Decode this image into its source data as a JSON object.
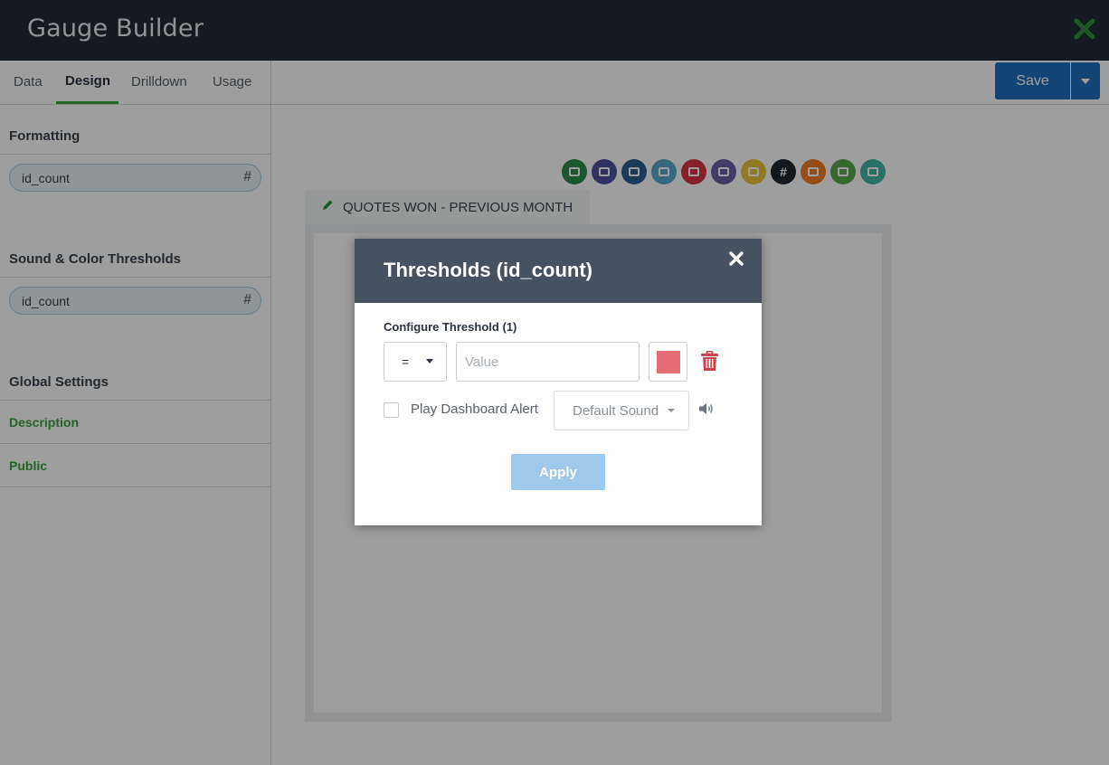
{
  "app": {
    "title": "Gauge Builder"
  },
  "sidebar": {
    "tabs": [
      {
        "label": "Data"
      },
      {
        "label": "Design"
      },
      {
        "label": "Drilldown"
      },
      {
        "label": "Usage"
      }
    ],
    "active_tab": "Design",
    "formatting": {
      "title": "Formatting",
      "field": "id_count",
      "field_type_symbol": "#"
    },
    "thresholds": {
      "title": "Sound & Color Thresholds",
      "field": "id_count",
      "field_type_symbol": "#"
    },
    "global": {
      "title": "Global Settings",
      "links": [
        "Description",
        "Public"
      ]
    }
  },
  "toolbar": {
    "save_label": "Save"
  },
  "chart_types": [
    {
      "icon": "funnel-icon",
      "color": "#2e8b4f"
    },
    {
      "icon": "camera-icon",
      "color": "#4c4f9e"
    },
    {
      "icon": "table-icon",
      "color": "#2c5d8f"
    },
    {
      "icon": "bar-chart-icon",
      "color": "#5aa7c9"
    },
    {
      "icon": "line-chart-icon",
      "color": "#d6364a"
    },
    {
      "icon": "list-icon",
      "color": "#6b5fa5"
    },
    {
      "icon": "pie-chart-icon",
      "color": "#e9c63c"
    },
    {
      "icon": "number-icon",
      "color": "#1f2730",
      "glyph": "#"
    },
    {
      "icon": "gauge-icon",
      "color": "#f07c28"
    },
    {
      "icon": "map-icon",
      "color": "#5da652"
    },
    {
      "icon": "trophy-icon",
      "color": "#43b7a6"
    }
  ],
  "widget": {
    "title": "QUOTES WON - PREVIOUS MONTH"
  },
  "modal": {
    "title": "Thresholds (id_count)",
    "config_label": "Configure Threshold (1)",
    "operator": "=",
    "value_placeholder": "Value",
    "color": "#e46c77",
    "alert_label": "Play Dashboard Alert",
    "sound_value": "Default Sound",
    "apply_label": "Apply"
  }
}
